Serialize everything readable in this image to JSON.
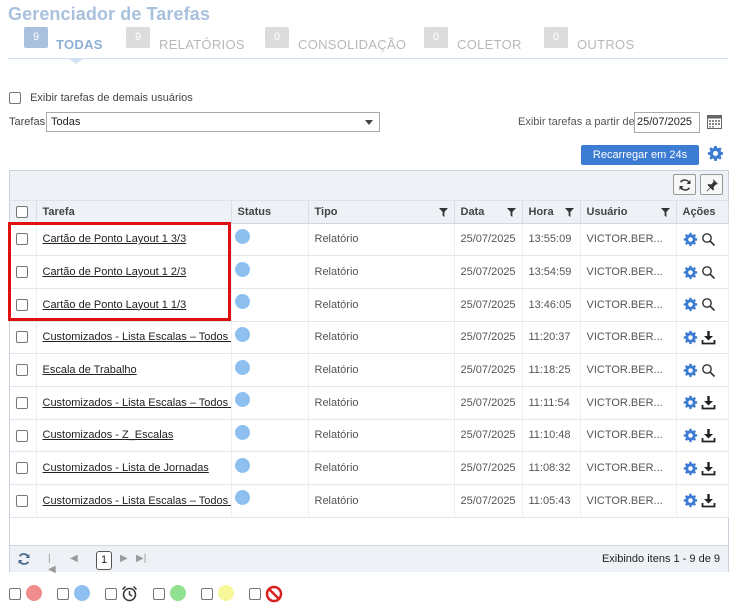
{
  "app": {
    "title": "Gerenciador de Tarefas"
  },
  "tabs": [
    {
      "count": "9",
      "label": "TODAS",
      "active": true
    },
    {
      "count": "9",
      "label": "RELATÓRIOS",
      "active": false
    },
    {
      "count": "0",
      "label": "CONSOLIDAÇÃO",
      "active": false
    },
    {
      "count": "0",
      "label": "COLETOR",
      "active": false
    },
    {
      "count": "0",
      "label": "OUTROS",
      "active": false
    }
  ],
  "filters": {
    "other_users_label": "Exibir tarefas de demais usuários",
    "tarefas_label": "Tarefas",
    "tarefas_value": "Todas",
    "date_label": "Exibir tarefas a partir de",
    "date_value": "25/07/2025"
  },
  "reload_button": "Recarregar em 24s",
  "columns": {
    "tarefa": "Tarefa",
    "status": "Status",
    "tipo": "Tipo",
    "data": "Data",
    "hora": "Hora",
    "usuario": "Usuário",
    "acoes": "Ações"
  },
  "rows": [
    {
      "tarefa": "Cartão de Ponto Layout 1 3/3",
      "tipo": "Relatório",
      "data": "25/07/2025",
      "hora": "13:55:09",
      "usuario": "VICTOR.BER...",
      "action_icon": "search-icon"
    },
    {
      "tarefa": "Cartão de Ponto Layout 1 2/3",
      "tipo": "Relatório",
      "data": "25/07/2025",
      "hora": "13:54:59",
      "usuario": "VICTOR.BER...",
      "action_icon": "search-icon"
    },
    {
      "tarefa": "Cartão de Ponto Layout 1 1/3",
      "tipo": "Relatório",
      "data": "25/07/2025",
      "hora": "13:46:05",
      "usuario": "VICTOR.BER...",
      "action_icon": "search-icon"
    },
    {
      "tarefa": "Customizados - Lista Escalas – Todos c",
      "tipo": "Relatório",
      "data": "25/07/2025",
      "hora": "11:20:37",
      "usuario": "VICTOR.BER...",
      "action_icon": "download-icon"
    },
    {
      "tarefa": "Escala de Trabalho",
      "tipo": "Relatório",
      "data": "25/07/2025",
      "hora": "11:18:25",
      "usuario": "VICTOR.BER...",
      "action_icon": "search-icon"
    },
    {
      "tarefa": "Customizados - Lista Escalas – Todos c",
      "tipo": "Relatório",
      "data": "25/07/2025",
      "hora": "11:11:54",
      "usuario": "VICTOR.BER...",
      "action_icon": "download-icon"
    },
    {
      "tarefa": "Customizados - Z_Escalas",
      "tipo": "Relatório",
      "data": "25/07/2025",
      "hora": "11:10:48",
      "usuario": "VICTOR.BER...",
      "action_icon": "download-icon"
    },
    {
      "tarefa": "Customizados - Lista de Jornadas",
      "tipo": "Relatório",
      "data": "25/07/2025",
      "hora": "11:08:32",
      "usuario": "VICTOR.BER...",
      "action_icon": "download-icon"
    },
    {
      "tarefa": "Customizados - Lista Escalas – Todos c",
      "tipo": "Relatório",
      "data": "25/07/2025",
      "hora": "11:05:43",
      "usuario": "VICTOR.BER...",
      "action_icon": "download-icon"
    }
  ],
  "pager": {
    "current_page": "1",
    "info": "Exibindo itens 1 - 9 de 9"
  },
  "legend": [
    {
      "icon": "red-dot",
      "color": "#f08c8c"
    },
    {
      "icon": "blue-dot",
      "color": "#8ec0ef"
    },
    {
      "icon": "alarm-clock-icon"
    },
    {
      "icon": "green-dot",
      "color": "#8fe08f"
    },
    {
      "icon": "yellow-dot",
      "color": "#f7f79a"
    },
    {
      "icon": "cancel-icon",
      "color": "#d82020"
    }
  ],
  "colors": {
    "accent": "#3d7cd3",
    "title": "#a9c1dd",
    "status_dot": "#8ec0ef",
    "highlight": "#e01010"
  }
}
